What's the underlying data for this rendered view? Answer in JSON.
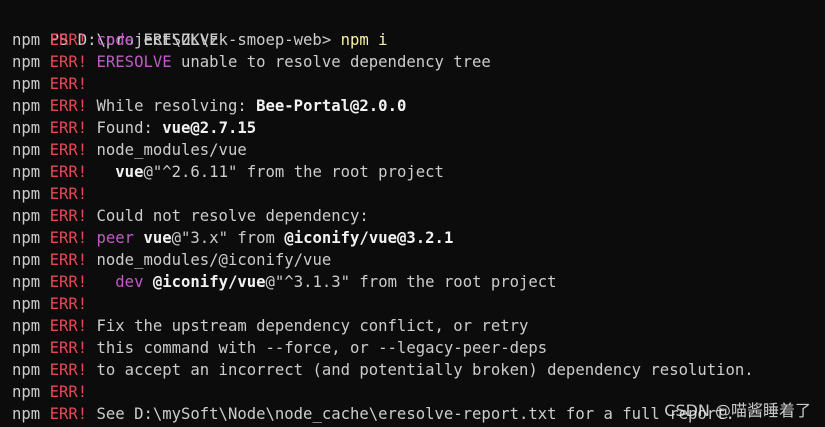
{
  "terminal": {
    "prompt": "PS D:\\project\\ZK\\zk-smoep-web> ",
    "command": "npm i",
    "colors": {
      "background": "#0c0c0c",
      "text": "#cccccc",
      "err": "#e74856",
      "code": "#c15ac6",
      "command": "#f9f1a5"
    },
    "lines": [
      [
        {
          "t": "npm ",
          "c": "w"
        },
        {
          "t": "ERR!",
          "c": "red"
        },
        {
          "t": " ",
          "c": "w"
        },
        {
          "t": "code",
          "c": "mag"
        },
        {
          "t": " ERESOLVE",
          "c": "w"
        }
      ],
      [
        {
          "t": "npm ",
          "c": "w"
        },
        {
          "t": "ERR!",
          "c": "red"
        },
        {
          "t": " ",
          "c": "w"
        },
        {
          "t": "ERESOLVE",
          "c": "mag"
        },
        {
          "t": " unable to resolve dependency tree",
          "c": "w"
        }
      ],
      [
        {
          "t": "npm ",
          "c": "w"
        },
        {
          "t": "ERR!",
          "c": "red"
        }
      ],
      [
        {
          "t": "npm ",
          "c": "w"
        },
        {
          "t": "ERR!",
          "c": "red"
        },
        {
          "t": " While resolving: ",
          "c": "w"
        },
        {
          "t": "Bee-Portal",
          "c": "bold"
        },
        {
          "t": "@2.0.0",
          "c": "bold"
        }
      ],
      [
        {
          "t": "npm ",
          "c": "w"
        },
        {
          "t": "ERR!",
          "c": "red"
        },
        {
          "t": " Found: ",
          "c": "w"
        },
        {
          "t": "vue",
          "c": "bold"
        },
        {
          "t": "@2.7.15",
          "c": "bold"
        }
      ],
      [
        {
          "t": "npm ",
          "c": "w"
        },
        {
          "t": "ERR!",
          "c": "red"
        },
        {
          "t": " node_modules/vue",
          "c": "w"
        }
      ],
      [
        {
          "t": "npm ",
          "c": "w"
        },
        {
          "t": "ERR!",
          "c": "red"
        },
        {
          "t": "   ",
          "c": "w"
        },
        {
          "t": "vue",
          "c": "bold"
        },
        {
          "t": "@\"^2.6.11\"",
          "c": "w"
        },
        {
          "t": " from the root project",
          "c": "w"
        }
      ],
      [
        {
          "t": "npm ",
          "c": "w"
        },
        {
          "t": "ERR!",
          "c": "red"
        }
      ],
      [
        {
          "t": "npm ",
          "c": "w"
        },
        {
          "t": "ERR!",
          "c": "red"
        },
        {
          "t": " Could not resolve dependency:",
          "c": "w"
        }
      ],
      [
        {
          "t": "npm ",
          "c": "w"
        },
        {
          "t": "ERR!",
          "c": "red"
        },
        {
          "t": " ",
          "c": "w"
        },
        {
          "t": "peer",
          "c": "mag"
        },
        {
          "t": " ",
          "c": "w"
        },
        {
          "t": "vue",
          "c": "bold"
        },
        {
          "t": "@\"3.x\"",
          "c": "w"
        },
        {
          "t": " from ",
          "c": "w"
        },
        {
          "t": "@iconify/vue",
          "c": "bold"
        },
        {
          "t": "@3.2.1",
          "c": "bold"
        }
      ],
      [
        {
          "t": "npm ",
          "c": "w"
        },
        {
          "t": "ERR!",
          "c": "red"
        },
        {
          "t": " node_modules/@iconify/vue",
          "c": "w"
        }
      ],
      [
        {
          "t": "npm ",
          "c": "w"
        },
        {
          "t": "ERR!",
          "c": "red"
        },
        {
          "t": "   ",
          "c": "w"
        },
        {
          "t": "dev",
          "c": "mag"
        },
        {
          "t": " ",
          "c": "w"
        },
        {
          "t": "@iconify/vue",
          "c": "bold"
        },
        {
          "t": "@\"^3.1.3\"",
          "c": "w"
        },
        {
          "t": " from the root project",
          "c": "w"
        }
      ],
      [
        {
          "t": "npm ",
          "c": "w"
        },
        {
          "t": "ERR!",
          "c": "red"
        }
      ],
      [
        {
          "t": "npm ",
          "c": "w"
        },
        {
          "t": "ERR!",
          "c": "red"
        },
        {
          "t": " Fix the upstream dependency conflict, or retry",
          "c": "w"
        }
      ],
      [
        {
          "t": "npm ",
          "c": "w"
        },
        {
          "t": "ERR!",
          "c": "red"
        },
        {
          "t": " this command with --force, or --legacy-peer-deps",
          "c": "w"
        }
      ],
      [
        {
          "t": "npm ",
          "c": "w"
        },
        {
          "t": "ERR!",
          "c": "red"
        },
        {
          "t": " to accept an incorrect (and potentially broken) dependency resolution.",
          "c": "w"
        }
      ],
      [
        {
          "t": "npm ",
          "c": "w"
        },
        {
          "t": "ERR!",
          "c": "red"
        }
      ],
      [
        {
          "t": "npm ",
          "c": "w"
        },
        {
          "t": "ERR!",
          "c": "red"
        },
        {
          "t": " See D:\\mySoft\\Node\\node_cache\\eresolve-report.txt for a full report.",
          "c": "w"
        }
      ]
    ]
  },
  "watermark": "CSDN @喵酱睡着了"
}
